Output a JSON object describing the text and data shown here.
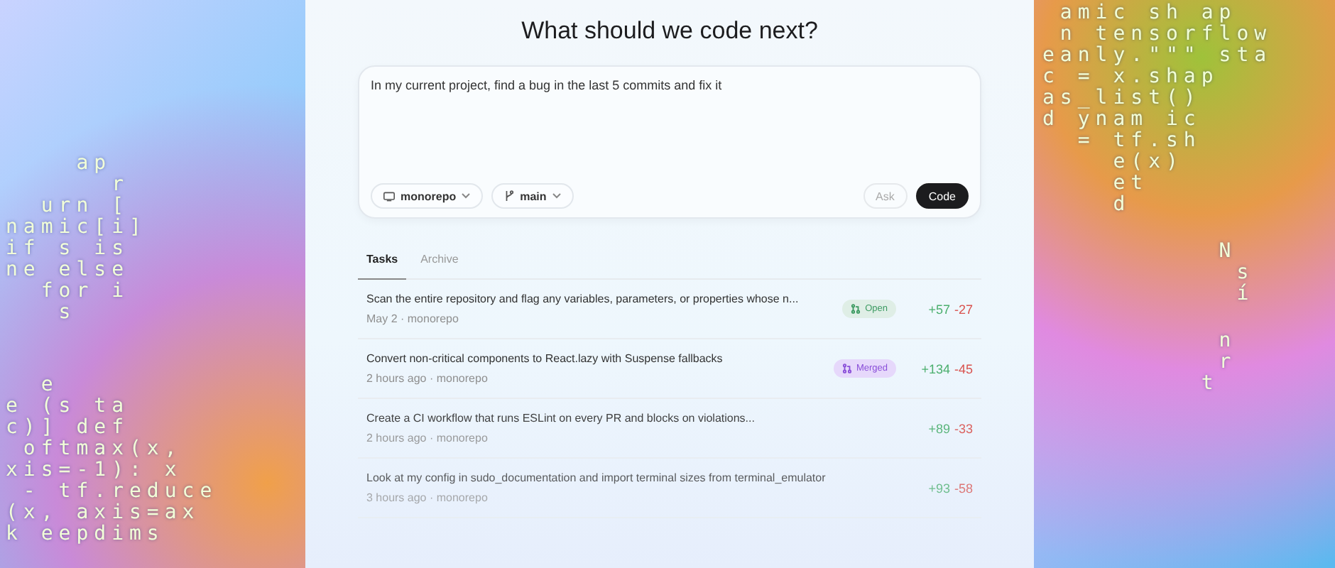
{
  "background_code_left": [
    [
      "    ap",
      "      r",
      "  urn [",
      "namic[i]",
      "if s is",
      "ne else",
      "  for i",
      "   s"
    ],
    [
      "  e",
      "e (s ta",
      "c)] def",
      " oftmax(x,",
      "xis=-1): x",
      " - tf.reduce",
      "(x, axis=ax",
      "k eepdims"
    ]
  ],
  "background_code_right": [
    [
      " amic sh ap",
      " n tensorflow",
      "eanly.\"\"\" sta",
      "c = x.shap",
      "as_list()",
      "d ynam ic",
      "  = tf.sh",
      "    e(x)",
      "    et",
      "    d"
    ],
    [
      "          N",
      "           s",
      "           í"
    ],
    [
      "          n",
      "          r",
      "         t"
    ]
  ],
  "heading": "What should we code next?",
  "composer": {
    "value": "In my current project, find a bug in the last 5 commits and fix it",
    "repo": "monorepo",
    "branch": "main",
    "buttons": [
      {
        "label": "Ask",
        "kind": "secondary"
      },
      {
        "label": "Code",
        "kind": "primary"
      }
    ]
  },
  "tabs": [
    {
      "label": "Tasks",
      "selected": true
    },
    {
      "label": "Archive",
      "selected": false
    }
  ],
  "tasks": [
    {
      "title": "Scan the entire repository and flag any variables, parameters, or properties whose n...",
      "meta": "May 2 · monorepo",
      "status": {
        "kind": "open",
        "label": "Open"
      },
      "added": "+57",
      "removed": "-27"
    },
    {
      "title": "Convert non-critical components to React.lazy with Suspense fallbacks",
      "meta": "2 hours ago · monorepo",
      "status": {
        "kind": "merged",
        "label": "Merged"
      },
      "added": "+134",
      "removed": "-45"
    },
    {
      "title": "Create a CI workflow that runs ESLint on every PR and blocks on violations...",
      "meta": "2 hours ago · monorepo",
      "added": "+89",
      "removed": "-33"
    },
    {
      "title": "Look at my config in sudo_documentation and import terminal sizes from terminal_emulator",
      "meta": "3 hours ago · monorepo",
      "added": "+93",
      "removed": "-58"
    }
  ]
}
